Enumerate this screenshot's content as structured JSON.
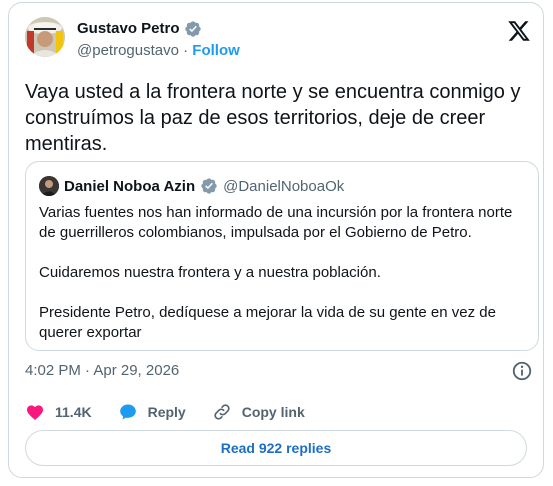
{
  "author": {
    "name": "Gustavo Petro",
    "handle": "@petrogustavo",
    "separator": "·",
    "follow_label": "Follow"
  },
  "tweet": {
    "text": "Vaya usted a la frontera norte y se encuentra conmigo y construímos la paz de esos territorios, deje de creer mentiras."
  },
  "quoted": {
    "name": "Daniel Noboa Azin",
    "handle": "@DanielNoboaOk",
    "paragraphs": [
      "Varias fuentes nos han informado de una incursión por la frontera norte de guerrilleros colombianos, impulsada por el Gobierno de Petro.",
      "Cuidaremos nuestra frontera y a nuestra población.",
      "Presidente Petro, dedíquese a mejorar la vida de su gente en vez de querer exportar"
    ]
  },
  "meta": {
    "timestamp": "4:02 PM · Apr 29, 2026"
  },
  "actions": {
    "likes_count": "11.4K",
    "reply_label": "Reply",
    "copy_link_label": "Copy link"
  },
  "replies_button_label": "Read 922 replies",
  "colors": {
    "accent": "#1d9bf0",
    "like": "#f91880",
    "verified": "#829aab",
    "border": "#cfd9de"
  },
  "icons": [
    "x-logo-icon",
    "verified-icon",
    "heart-icon",
    "speech-bubble-icon",
    "link-icon",
    "info-icon"
  ]
}
